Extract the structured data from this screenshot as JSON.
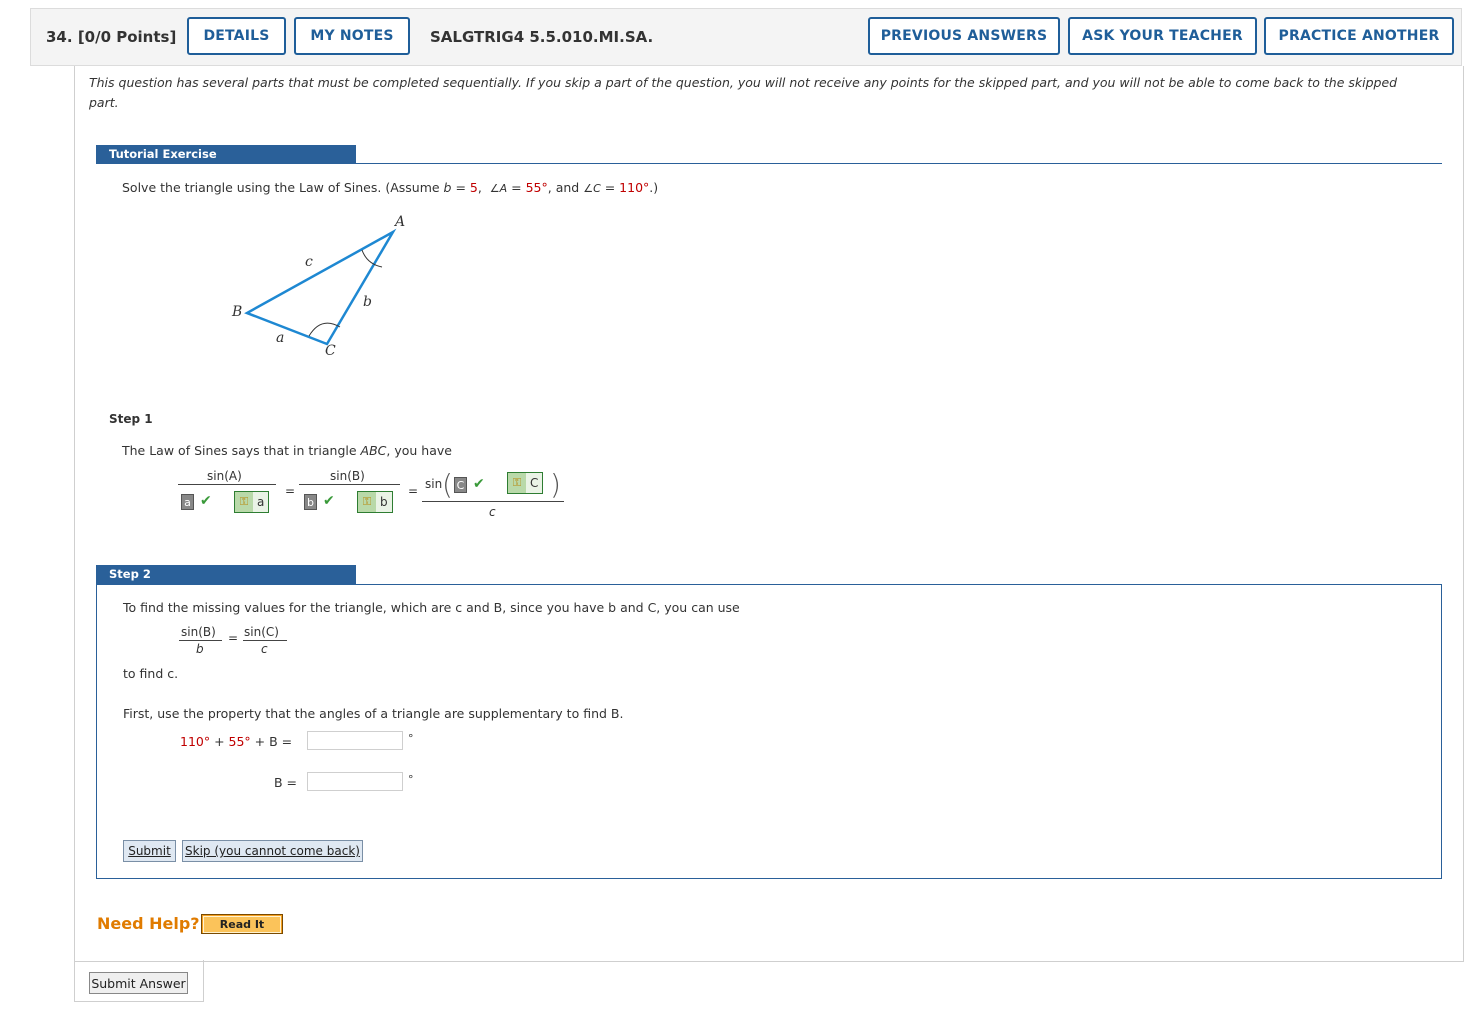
{
  "header": {
    "question_number": "34.",
    "points": "[0/0 Points]",
    "details_label": "DETAILS",
    "my_notes_label": "MY NOTES",
    "question_code": "SALGTRIG4 5.5.010.MI.SA.",
    "previous_answers_label": "PREVIOUS ANSWERS",
    "ask_teacher_label": "ASK YOUR TEACHER",
    "practice_another_label": "PRACTICE ANOTHER"
  },
  "intro": "This question has several parts that must be completed sequentially. If you skip a part of the question, you will not receive any points for the skipped part, and you will not be able to come back to the skipped part.",
  "tutorial": {
    "heading": "Tutorial Exercise",
    "prompt_start": "Solve the triangle using the Law of Sines. (Assume ",
    "b_var": "b",
    "eq": " = ",
    "b_val": "5",
    "comma": ",",
    "angle_A": "∠A",
    "A_val": "55°",
    "and_word": ", and ",
    "angle_C": "∠C",
    "C_val": "110°",
    "prompt_end": ".)",
    "diagram": {
      "A": "A",
      "B": "B",
      "C": "C",
      "a": "a",
      "b": "b",
      "c": "c"
    }
  },
  "step1": {
    "heading": "Step 1",
    "text_start": "The Law of Sines says that in triangle ",
    "triangle": "ABC",
    "text_end": ", you have",
    "sinA": "sin(A)",
    "sinB": "sin(B)",
    "sin_prefix": "sin",
    "equals": "=",
    "denom_c": "c",
    "answers": {
      "a_given": "a",
      "a_key": "a",
      "b_given": "b",
      "b_key": "b",
      "c_given": "C",
      "c_key": "C"
    }
  },
  "step2": {
    "heading": "Step 2",
    "text": "To find the missing values for the triangle, which are c and B, since you have b and C, you can use",
    "frac_left_num": "sin(B)",
    "frac_left_den": "b",
    "frac_right_num": "sin(C)",
    "frac_right_den": "c",
    "equals": "=",
    "to_find": "to find c.",
    "property_text": "First, use the property that the angles of a triangle are supplementary to find B.",
    "eq1_c": "110°",
    "eq1_plus1": " + ",
    "eq1_a": "55°",
    "eq1_rest": " + B  = ",
    "eq2": "B  = ",
    "input1_value": "",
    "input2_value": "",
    "degree": "°",
    "submit_label": "Submit",
    "skip_label": "Skip (you cannot come back)"
  },
  "help": {
    "label": "Need Help?",
    "read_it_label": "Read It"
  },
  "submit_answer_label": "Submit Answer",
  "colors": {
    "brand_blue": "#1f5e99",
    "tab_blue": "#2a6099",
    "given_red": "#c00000",
    "help_orange": "#e07b00",
    "triangle_blue": "#1e88d2"
  }
}
